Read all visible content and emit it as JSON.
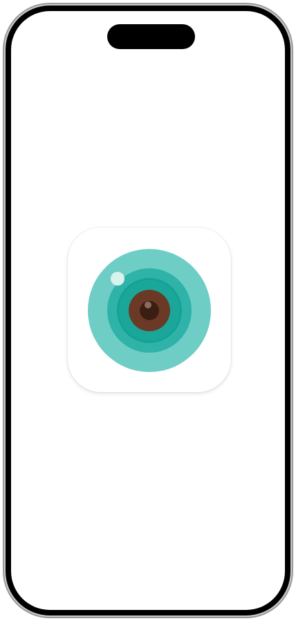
{
  "screen": {
    "background": "#ffffff",
    "app_icon": {
      "icon": "camera-eye-icon",
      "colors": {
        "outer_ring": "#6ecdc4",
        "middle_ring": "#2fb3a8",
        "inner_ring": "#14a295",
        "iris": "#6b3a26",
        "pupil": "#3b1e12",
        "highlight": "#d8f2ee"
      }
    }
  },
  "device": {
    "frame_color": "#000000",
    "rim_color": "#c9c9cc"
  }
}
